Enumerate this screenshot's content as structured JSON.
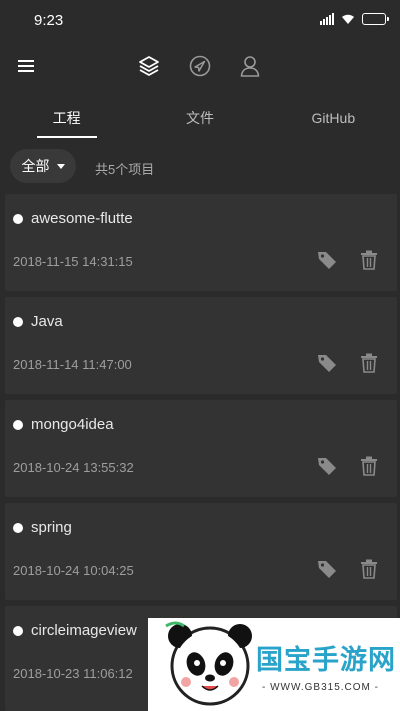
{
  "status_bar": {
    "time": "9:23"
  },
  "tabs": [
    {
      "label": "工程",
      "active": true
    },
    {
      "label": "文件",
      "active": false
    },
    {
      "label": "GitHub",
      "active": false
    }
  ],
  "filter": {
    "label": "全部",
    "count_text": "共5个项目"
  },
  "projects": [
    {
      "name": "awesome-flutte",
      "date": "2018-11-15 14:31:15"
    },
    {
      "name": "Java",
      "date": "2018-11-14 11:47:00"
    },
    {
      "name": "mongo4idea",
      "date": "2018-10-24 13:55:32"
    },
    {
      "name": "spring",
      "date": "2018-10-24 10:04:25"
    },
    {
      "name": "circleimageview",
      "date": "2018-10-23 11:06:12"
    }
  ],
  "watermark": {
    "title": "国宝手游网",
    "url": "- WWW.GB315.COM -"
  },
  "colors": {
    "background": "#2b2b2b",
    "card": "#333333",
    "battery": "#3ecf4a",
    "watermark_text": "#29a3c9"
  }
}
